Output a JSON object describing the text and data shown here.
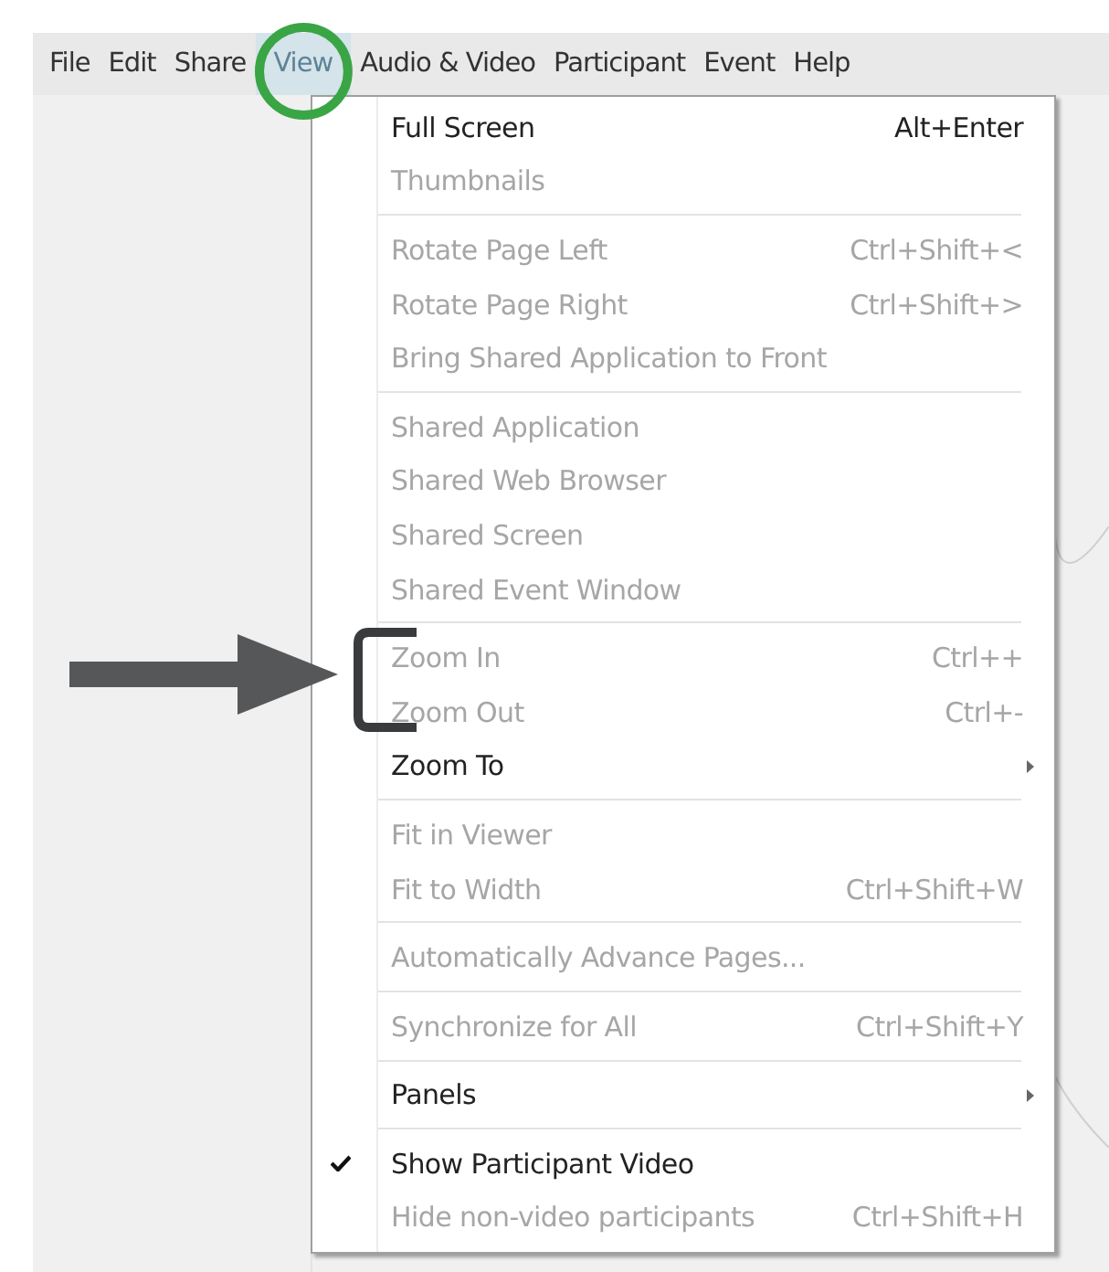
{
  "menubar": [
    {
      "label": "File",
      "selected": false
    },
    {
      "label": "Edit",
      "selected": false
    },
    {
      "label": "Share",
      "selected": false
    },
    {
      "label": "View",
      "selected": true
    },
    {
      "label": "Audio & Video",
      "selected": false
    },
    {
      "label": "Participant",
      "selected": false
    },
    {
      "label": "Event",
      "selected": false
    },
    {
      "label": "Help",
      "selected": false
    }
  ],
  "view_menu": [
    {
      "kind": "item",
      "label": "Full Screen",
      "shortcut": "Alt+Enter",
      "disabled": false,
      "checked": false
    },
    {
      "kind": "item",
      "label": "Thumbnails",
      "disabled": true,
      "checked": false
    },
    {
      "kind": "separator"
    },
    {
      "kind": "item",
      "label": "Rotate Page Left",
      "shortcut": "Ctrl+Shift+<",
      "disabled": true,
      "checked": false
    },
    {
      "kind": "item",
      "label": "Rotate Page Right",
      "shortcut": "Ctrl+Shift+>",
      "disabled": true,
      "checked": false
    },
    {
      "kind": "item",
      "label": "Bring Shared Application to Front",
      "disabled": true,
      "checked": false
    },
    {
      "kind": "separator"
    },
    {
      "kind": "item",
      "label": "Shared Application",
      "disabled": true,
      "checked": false
    },
    {
      "kind": "item",
      "label": "Shared Web Browser",
      "disabled": true,
      "checked": false
    },
    {
      "kind": "item",
      "label": "Shared Screen",
      "disabled": true,
      "checked": false
    },
    {
      "kind": "item",
      "label": "Shared Event Window",
      "disabled": true,
      "checked": false
    },
    {
      "kind": "separator"
    },
    {
      "kind": "item",
      "label": "Zoom In",
      "shortcut": "Ctrl++",
      "disabled": true,
      "checked": false
    },
    {
      "kind": "item",
      "label": "Zoom Out",
      "shortcut": "Ctrl+-",
      "disabled": true,
      "checked": false
    },
    {
      "kind": "submenu",
      "label": "Zoom To",
      "disabled": false,
      "checked": false
    },
    {
      "kind": "separator"
    },
    {
      "kind": "item",
      "label": "Fit in Viewer",
      "disabled": true,
      "checked": false
    },
    {
      "kind": "item",
      "label": "Fit to Width",
      "shortcut": "Ctrl+Shift+W",
      "disabled": true,
      "checked": false
    },
    {
      "kind": "separator"
    },
    {
      "kind": "item",
      "label": "Automatically Advance Pages...",
      "disabled": true,
      "checked": false
    },
    {
      "kind": "separator"
    },
    {
      "kind": "item",
      "label": "Synchronize for All",
      "shortcut": "Ctrl+Shift+Y",
      "disabled": true,
      "checked": false
    },
    {
      "kind": "separator"
    },
    {
      "kind": "submenu",
      "label": "Panels",
      "disabled": false,
      "checked": false
    },
    {
      "kind": "separator"
    },
    {
      "kind": "item",
      "label": "Show Participant Video",
      "disabled": false,
      "checked": true
    },
    {
      "kind": "item",
      "label": "Hide non-video participants",
      "shortcut": "Ctrl+Shift+H",
      "disabled": true,
      "checked": false
    }
  ]
}
